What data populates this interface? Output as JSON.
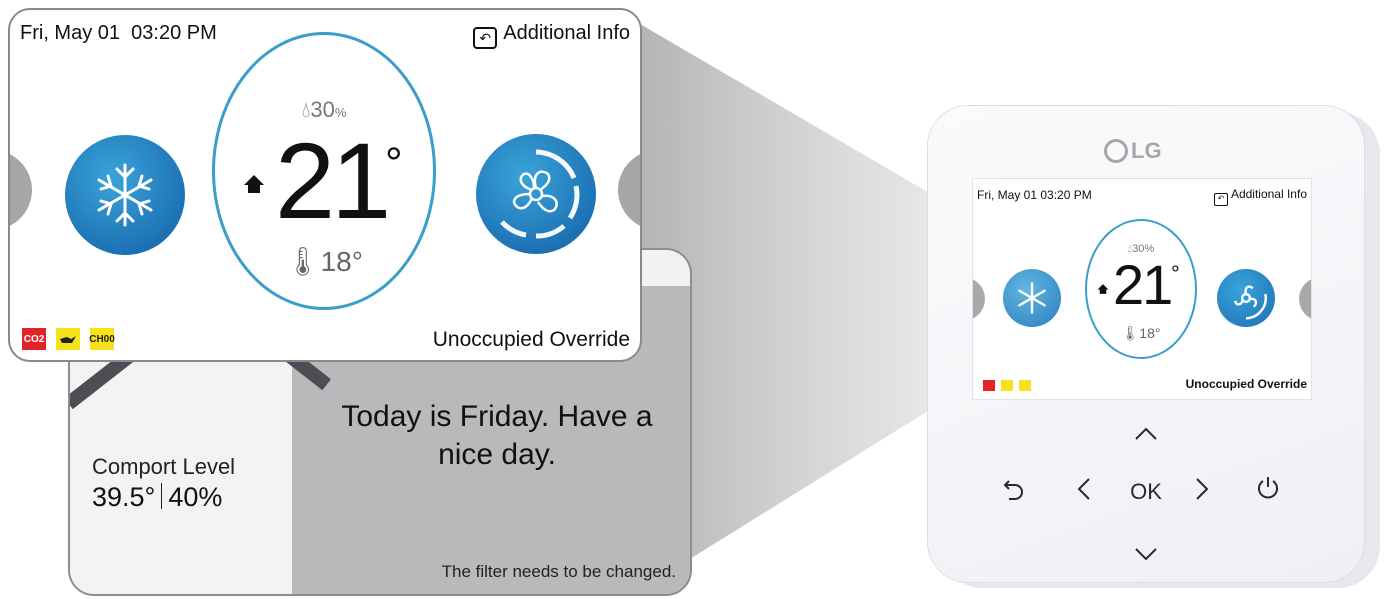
{
  "screen": {
    "date": "Fri, May 01",
    "time": "03:20 PM",
    "additional_info_label": "Additional Info",
    "humidity_value": "30",
    "humidity_unit": "%",
    "current_temp": "21",
    "current_temp_unit": "°",
    "set_temp": "18°",
    "override_label": "Unoccupied Override",
    "badges": {
      "co2": "CO2",
      "ch_line1": "CH",
      "ch_line2": "00"
    },
    "mode": "snowflake-icon",
    "fan": "fan-icon"
  },
  "info_screen": {
    "comfort_label": "Comport Level",
    "comfort_temp": "39.5°",
    "comfort_humidity": "40%",
    "greeting": "Today is Friday. Have a nice day.",
    "filter_message": "The filter needs to be changed."
  },
  "device": {
    "brand": "LG",
    "ok_label": "OK",
    "mini_date": "Fri, May 01  03:20 PM",
    "mini_humidity": "30",
    "mini_humidity_unit": "%"
  },
  "colors": {
    "accent_blue": "#1b6fb3",
    "dial_ring": "#3a9ec8",
    "co2_badge": "#e3232a",
    "warning_badge": "#f4e21b"
  }
}
